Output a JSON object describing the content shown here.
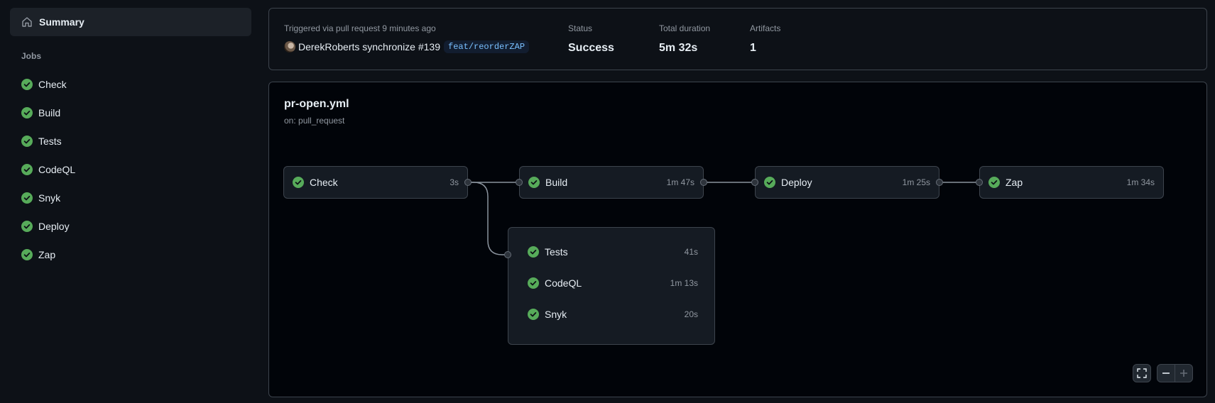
{
  "sidebar": {
    "summary_label": "Summary",
    "jobs_title": "Jobs",
    "jobs": [
      "Check",
      "Build",
      "Tests",
      "CodeQL",
      "Snyk",
      "Deploy",
      "Zap"
    ]
  },
  "run": {
    "trigger_label": "Triggered via pull request 9 minutes ago",
    "actor": "DerekRoberts",
    "action": "synchronize #139",
    "branch": "feat/reorderZAP",
    "status_label": "Status",
    "status_value": "Success",
    "duration_label": "Total duration",
    "duration_value": "5m 32s",
    "artifacts_label": "Artifacts",
    "artifacts_value": "1"
  },
  "workflow": {
    "name": "pr-open.yml",
    "trigger": "on: pull_request",
    "nodes": {
      "check": {
        "name": "Check",
        "duration": "3s"
      },
      "build": {
        "name": "Build",
        "duration": "1m 47s"
      },
      "deploy": {
        "name": "Deploy",
        "duration": "1m 25s"
      },
      "zap": {
        "name": "Zap",
        "duration": "1m 34s"
      }
    },
    "group": [
      {
        "name": "Tests",
        "duration": "41s"
      },
      {
        "name": "CodeQL",
        "duration": "1m 13s"
      },
      {
        "name": "Snyk",
        "duration": "20s"
      }
    ]
  },
  "colors": {
    "success": "#57ab5a",
    "background": "#0d1117",
    "canvas": "#010409",
    "border": "#3d444d"
  },
  "icons": {
    "summary": "home-icon",
    "job_status": "check-circle-icon",
    "fullscreen": "fullscreen-icon",
    "zoom_out": "minus-icon",
    "zoom_in": "plus-icon"
  }
}
